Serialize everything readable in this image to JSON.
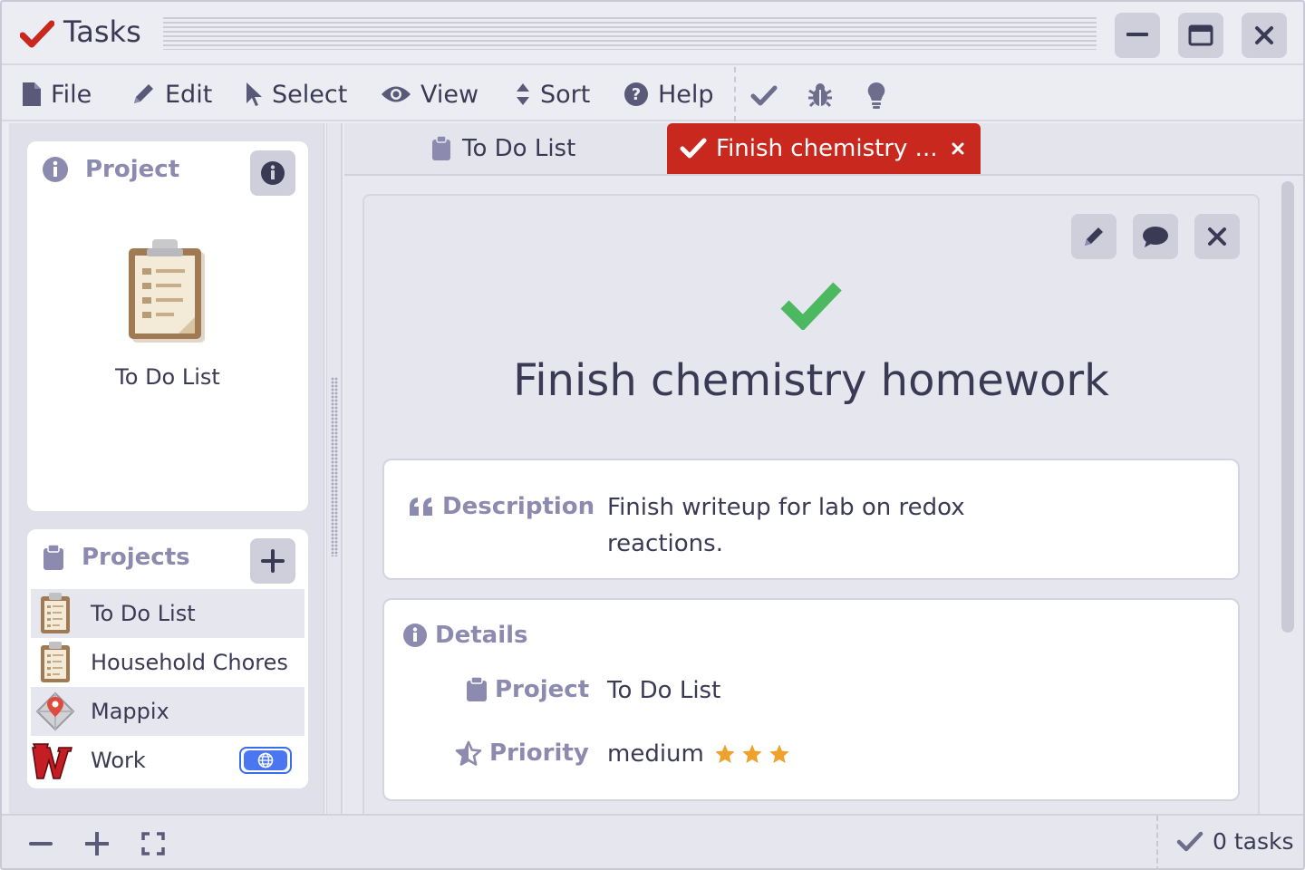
{
  "app": {
    "title": "Tasks"
  },
  "menu": {
    "file": "File",
    "edit": "Edit",
    "select": "Select",
    "view": "View",
    "sort": "Sort",
    "help": "Help"
  },
  "toolbar": {
    "icons": [
      "check-icon",
      "bug-icon",
      "lightbulb-icon"
    ]
  },
  "sidebar": {
    "project_card": {
      "heading": "Project",
      "project_name": "To Do List"
    },
    "projects_card": {
      "heading": "Projects",
      "items": [
        {
          "label": "To Do List",
          "icon": "clipboard-icon",
          "selected": true
        },
        {
          "label": "Household Chores",
          "icon": "clipboard-icon",
          "selected": false
        },
        {
          "label": "Mappix",
          "icon": "map-pin-icon",
          "selected": true
        },
        {
          "label": "Work",
          "icon": "w-logo-icon",
          "selected": false,
          "shared": true
        }
      ]
    }
  },
  "tabs": [
    {
      "label": "To Do List",
      "active": false
    },
    {
      "label": "Finish chemistry ...",
      "active": true
    }
  ],
  "task": {
    "title": "Finish chemistry homework",
    "description_label": "Description",
    "description_line1": "Finish writeup for lab on redox",
    "description_line2": "reactions.",
    "details_label": "Details",
    "project_label": "Project",
    "project_value": "To Do List",
    "priority_label": "Priority",
    "priority_value": "medium",
    "priority_stars": 3
  },
  "statusbar": {
    "task_count": "0 tasks"
  },
  "colors": {
    "accent_red": "#c8281e",
    "check_green": "#4cb860",
    "star_orange": "#f0a12b",
    "label_purple": "#8c8aae",
    "text_dark": "#3b3a55"
  }
}
